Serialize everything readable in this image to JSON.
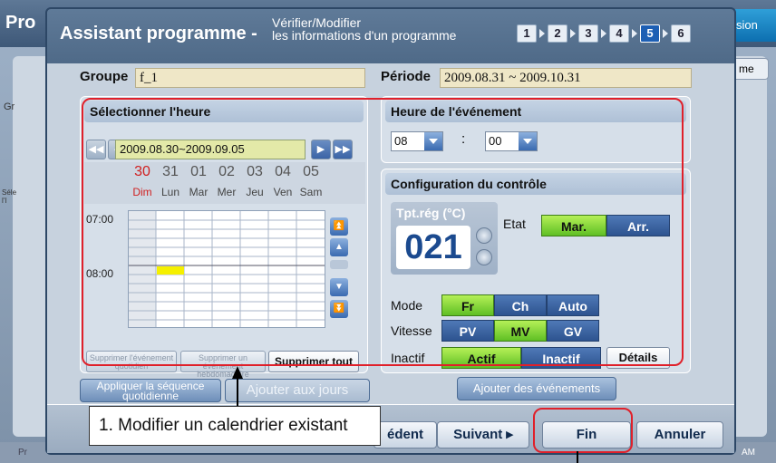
{
  "background": {
    "title_fragment": "Pro",
    "right_button_fragment": "sion",
    "right_tab_fragment": "me",
    "left_label": "Gr",
    "left_small_label": "Séle\nl'I",
    "status_left": "Pr",
    "status_right": "AM"
  },
  "dialog": {
    "title": "Assistant programme -",
    "subtitle_line1": "Vérifier/Modifier",
    "subtitle_line2": "les informations d'un programme",
    "steps": [
      "1",
      "2",
      "3",
      "4",
      "5",
      "6"
    ],
    "active_step": "5"
  },
  "group": {
    "label": "Groupe",
    "value": "f_1"
  },
  "period": {
    "label": "Période",
    "value": "2009.08.31 ~ 2009.10.31"
  },
  "time_select": {
    "title": "Sélectionner l'heure",
    "date_range": "2009.08.30~2009.09.05",
    "day_numbers": [
      "30",
      "31",
      "01",
      "02",
      "03",
      "04",
      "05"
    ],
    "day_names": [
      "Dim",
      "Lun",
      "Mar",
      "Mer",
      "Jeu",
      "Ven",
      "Sam"
    ],
    "times": [
      "07:00",
      "08:00"
    ],
    "btn_delete_daily": "Supprimer l'événement quotidien",
    "btn_delete_weekly": "Supprimer un événement hebdomadaire",
    "btn_delete_all": "Supprimer tout"
  },
  "event_time": {
    "title": "Heure de l'événement",
    "hour": "08",
    "separator": ":",
    "minute": "00"
  },
  "control": {
    "title": "Configuration du contrôle",
    "temp_label": "Tpt.rég (°C)",
    "temp_value": "021",
    "etat_label": "Etat",
    "etat_on": "Mar.",
    "etat_off": "Arr.",
    "mode_label": "Mode",
    "mode_options": [
      "Fr",
      "Ch",
      "Auto"
    ],
    "mode_selected": "Fr",
    "speed_label": "Vitesse",
    "speed_options": [
      "PV",
      "MV",
      "GV"
    ],
    "speed_selected": "MV",
    "inactive_label": "Inactif",
    "inactive_options": [
      "Actif",
      "Inactif"
    ],
    "inactive_selected": "Actif",
    "details": "Détails"
  },
  "actions": {
    "apply_daily": "Appliquer la séquence quotidienne",
    "add_days": "Ajouter aux jours",
    "add_events": "Ajouter des événements"
  },
  "footer": {
    "previous": "édent",
    "next": "Suivant ▸",
    "finish": "Fin",
    "cancel": "Annuler"
  },
  "callout": {
    "text": "1. Modifier un calendrier existant"
  }
}
